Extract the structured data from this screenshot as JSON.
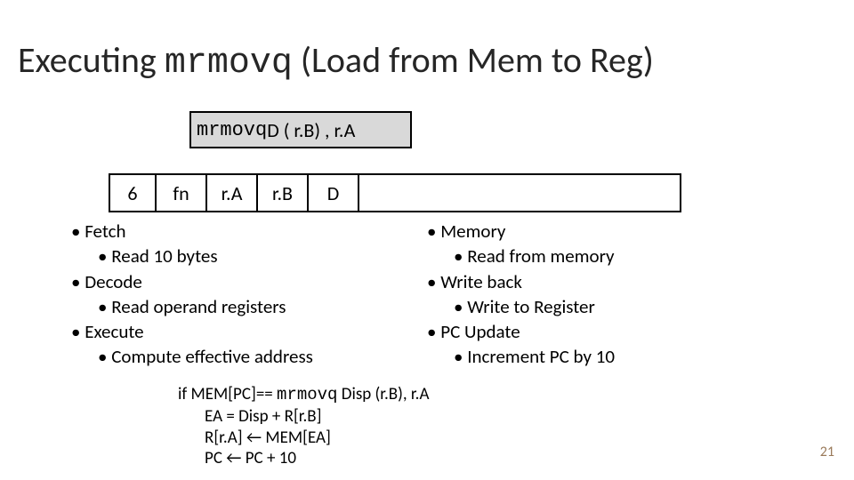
{
  "title": {
    "pre": "Executing ",
    "mono": "mrmovq",
    "post": "  (Load from Mem to Reg)"
  },
  "syntax": {
    "mono": "mrmovq",
    "rest": " D ( r.B) , r.A"
  },
  "encoding": {
    "c1": "6",
    "c2": "fn",
    "c3": "r.A",
    "c4": "r.B",
    "c5": "D",
    "c6": ""
  },
  "left": {
    "fetch": "Fetch",
    "fetch_sub": "Read 10 bytes",
    "decode": "Decode",
    "decode_sub": "Read operand registers",
    "execute": "Execute",
    "execute_sub": "Compute effective address"
  },
  "right": {
    "memory": "Memory",
    "memory_sub": "Read from memory",
    "wb": "Write back",
    "wb_sub": "Write to Register",
    "pc": "PC Update",
    "pc_sub": "Increment PC by 10"
  },
  "pseudo": {
    "l1a": "if MEM[PC]== ",
    "l1b": "mrmovq",
    "l1c": " Disp (r.B), r.A",
    "l2": "EA = Disp + R[r.B]",
    "l3": "R[r.A] ← MEM[EA]",
    "l4": "PC ← PC + 10"
  },
  "pagenum": "21"
}
